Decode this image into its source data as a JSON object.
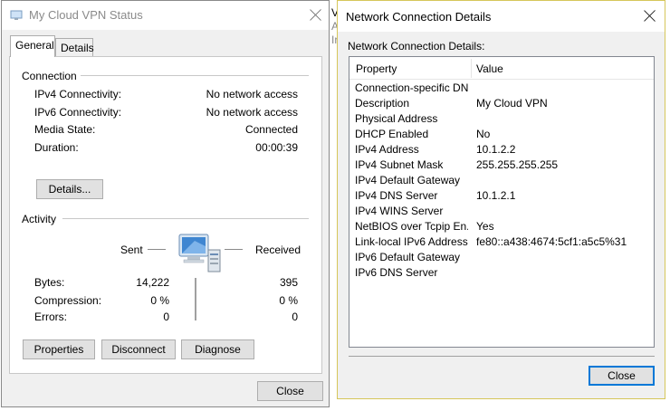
{
  "background_fragments": [
    "V",
    "A",
    "Ir"
  ],
  "status_window": {
    "title": "My Cloud VPN Status",
    "tabs": [
      {
        "label": "General"
      },
      {
        "label": "Details"
      }
    ],
    "connection": {
      "heading": "Connection",
      "rows": [
        {
          "label": "IPv4 Connectivity:",
          "value": "No network access"
        },
        {
          "label": "IPv6 Connectivity:",
          "value": "No network access"
        },
        {
          "label": "Media State:",
          "value": "Connected"
        },
        {
          "label": "Duration:",
          "value": "00:00:39"
        }
      ],
      "details_button": "Details..."
    },
    "activity": {
      "heading": "Activity",
      "sent_label": "Sent",
      "received_label": "Received",
      "rows": [
        {
          "label": "Bytes:",
          "sent": "14,222",
          "received": "395"
        },
        {
          "label": "Compression:",
          "sent": "0 %",
          "received": "0 %"
        },
        {
          "label": "Errors:",
          "sent": "0",
          "received": "0"
        }
      ]
    },
    "buttons": {
      "properties": "Properties",
      "disconnect": "Disconnect",
      "diagnose": "Diagnose",
      "close": "Close"
    }
  },
  "details_window": {
    "title": "Network Connection Details",
    "subtitle": "Network Connection Details:",
    "columns": {
      "property": "Property",
      "value": "Value"
    },
    "rows": [
      {
        "property": "Connection-specific DN...",
        "value": ""
      },
      {
        "property": "Description",
        "value": "My Cloud VPN"
      },
      {
        "property": "Physical Address",
        "value": ""
      },
      {
        "property": "DHCP Enabled",
        "value": "No"
      },
      {
        "property": "IPv4 Address",
        "value": "10.1.2.2"
      },
      {
        "property": "IPv4 Subnet Mask",
        "value": "255.255.255.255"
      },
      {
        "property": "IPv4 Default Gateway",
        "value": ""
      },
      {
        "property": "IPv4 DNS Server",
        "value": "10.1.2.1"
      },
      {
        "property": "IPv4 WINS Server",
        "value": ""
      },
      {
        "property": "NetBIOS over Tcpip En...",
        "value": "Yes"
      },
      {
        "property": "Link-local IPv6 Address",
        "value": "fe80::a438:4674:5cf1:a5c5%31"
      },
      {
        "property": "IPv6 Default Gateway",
        "value": ""
      },
      {
        "property": "IPv6 DNS Server",
        "value": ""
      }
    ],
    "close_button": "Close"
  },
  "icons": {
    "title_icon": "network-icon",
    "activity_icon": "computer-network-icon"
  },
  "colors": {
    "focus_border": "#0078d7",
    "details_border": "#d6c65a"
  }
}
